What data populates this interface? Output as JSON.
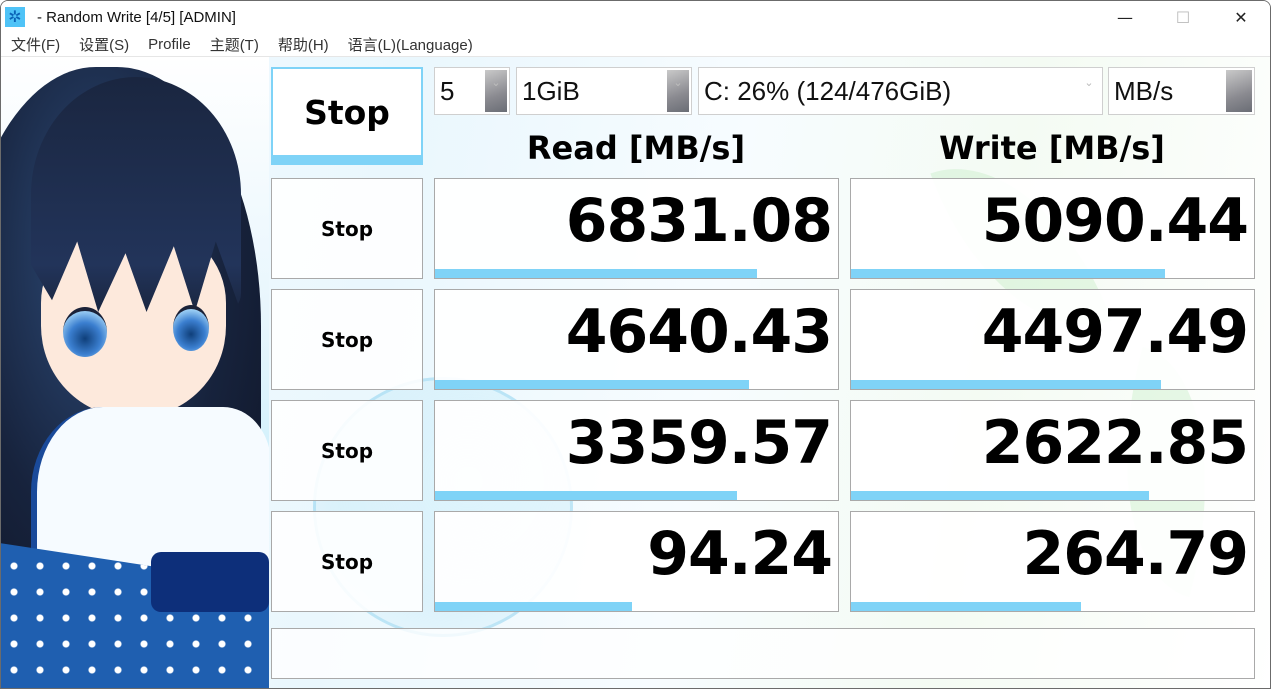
{
  "window": {
    "title": "- Random Write [4/5] [ADMIN]",
    "app_icon": "snowflake-icon",
    "controls": {
      "minimize": "—",
      "maximize": "☐",
      "close": "✕"
    }
  },
  "menu": {
    "items": [
      {
        "label": "文件(F)"
      },
      {
        "label": "设置(S)"
      },
      {
        "label": "Profile"
      },
      {
        "label": "主题(T)"
      },
      {
        "label": "帮助(H)"
      },
      {
        "label": "语言(L)(Language)"
      }
    ]
  },
  "toolbar": {
    "all_button_label": "Stop",
    "test_count": {
      "value": "5"
    },
    "test_size": {
      "value": "1GiB"
    },
    "drive": {
      "value": "C: 26% (124/476GiB)"
    },
    "unit": {
      "value": "MB/s"
    }
  },
  "headers": {
    "read": "Read [MB/s]",
    "write": "Write [MB/s]"
  },
  "rows": [
    {
      "button_label": "Stop",
      "read": "6831.08",
      "read_bar_percent": 80,
      "write": "5090.44",
      "write_bar_percent": 78
    },
    {
      "button_label": "Stop",
      "read": "4640.43",
      "read_bar_percent": 78,
      "write": "4497.49",
      "write_bar_percent": 77
    },
    {
      "button_label": "Stop",
      "read": "3359.57",
      "read_bar_percent": 75,
      "write": "2622.85",
      "write_bar_percent": 74
    },
    {
      "button_label": "Stop",
      "read": "94.24",
      "read_bar_percent": 49,
      "write": "264.79",
      "write_bar_percent": 57
    }
  ],
  "comment": {
    "value": ""
  },
  "colors": {
    "accent": "#7fd3f7",
    "border": "#a9a9a9"
  }
}
